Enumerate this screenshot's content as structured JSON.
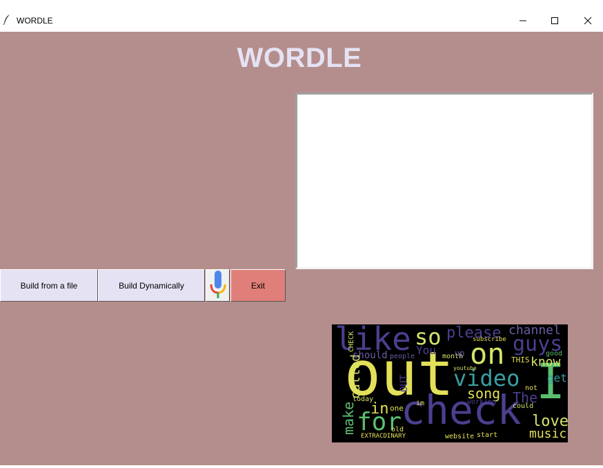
{
  "window": {
    "title": "WORDLE",
    "icon": "feather-icon",
    "controls": [
      "minimize-icon",
      "maximize-icon",
      "close-icon"
    ]
  },
  "heading": "WORDLE",
  "textbox": {
    "value": ""
  },
  "buttons": {
    "build_file": "Build from a file",
    "build_dynamic": "Build Dynamically",
    "mic_icon": "microphone-icon",
    "exit": "Exit"
  },
  "colors": {
    "background": "#b48e8c",
    "heading": "#e4e2f3",
    "button": "#e4e2f3",
    "exit_button": "#e07f79"
  },
  "wordcloud": {
    "words": [
      "out",
      "check",
      "like",
      "so",
      "please",
      "channel",
      "guys",
      "on",
      "I",
      "video",
      "know",
      "for",
      "in",
      "make",
      "called",
      "song",
      "love",
      "music",
      "The",
      "get",
      "should",
      "You",
      "subscribe",
      "month",
      "THIS",
      "good",
      "people",
      "today",
      "youtube",
      "one",
      "working",
      "could",
      "not",
      "old",
      "website",
      "start",
      "EXTRACDINARY",
      "OUT",
      "CHECK",
      "im",
      "up"
    ]
  }
}
